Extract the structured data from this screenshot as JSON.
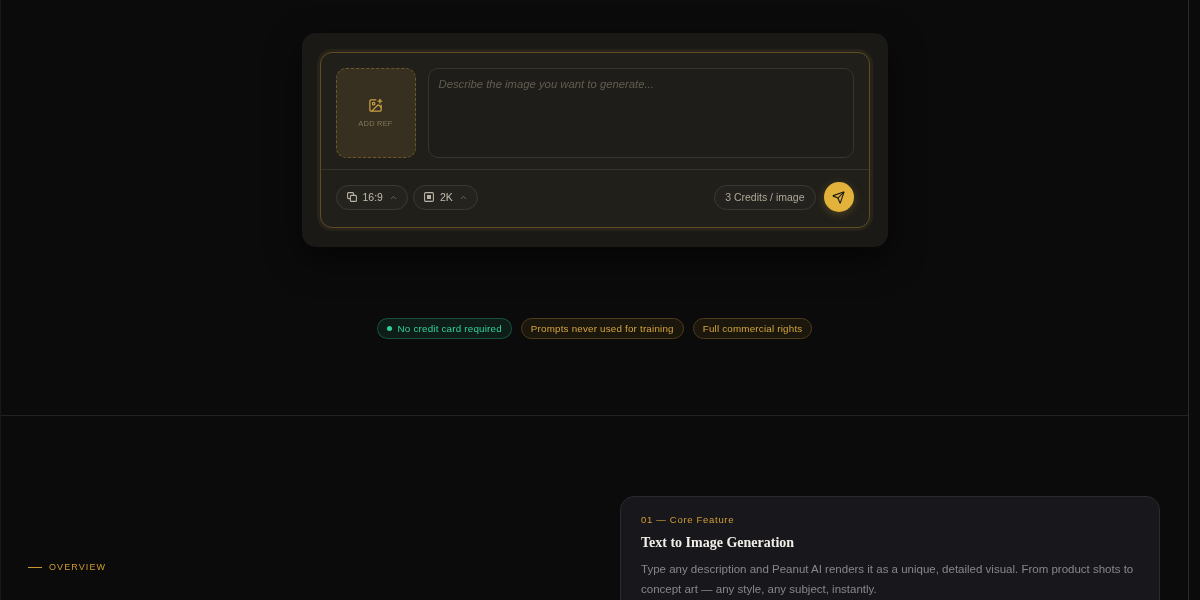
{
  "prompt_box": {
    "reference_upload": {
      "label": "ADD REF"
    },
    "prompt_field": {
      "placeholder": "Describe the image you want to generate..."
    },
    "options": [
      {
        "kind": "aspect_ratio",
        "value": "16:9"
      },
      {
        "kind": "resolution",
        "value": "2K"
      }
    ],
    "cost": "3 Credits / image"
  },
  "trust_badges": [
    {
      "kind": "dot",
      "label": "No credit card required",
      "color": "#2fd39a"
    },
    {
      "kind": "plain",
      "label": "Prompts never used for training",
      "color": "#4d3d1b"
    },
    {
      "kind": "plain",
      "label": "Full commercial rights",
      "color": "#4d3d1b"
    }
  ],
  "overview": {
    "eyebrow": "OVERVIEW"
  },
  "features": [
    {
      "number_label": "01 — Core Feature",
      "title": "Text to Image Generation",
      "description": "Type any description and Peanut AI renders it as a unique, detailed visual. From product shots to concept art — any style, any subject, instantly."
    }
  ]
}
